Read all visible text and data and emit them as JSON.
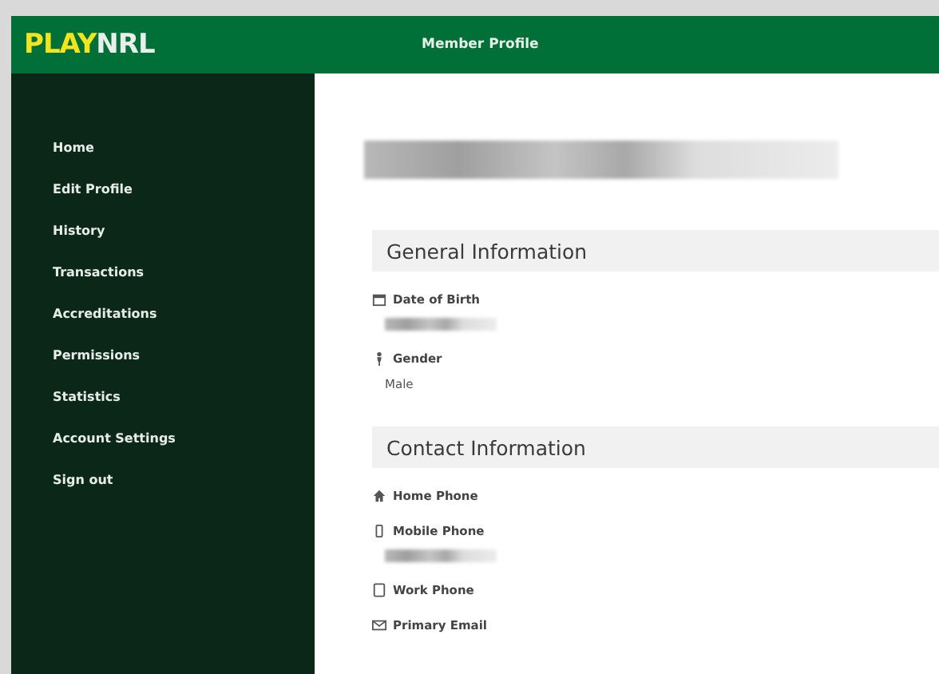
{
  "header": {
    "logo_part_1": "PLAY",
    "logo_part_2": "NRL",
    "title": "Member Profile"
  },
  "sidebar": {
    "items": [
      {
        "label": "Home"
      },
      {
        "label": "Edit Profile"
      },
      {
        "label": "History"
      },
      {
        "label": "Transactions"
      },
      {
        "label": "Accreditations"
      },
      {
        "label": "Permissions"
      },
      {
        "label": "Statistics"
      },
      {
        "label": "Account Settings"
      },
      {
        "label": "Sign out"
      }
    ]
  },
  "profile": {
    "name_hidden": true
  },
  "sections": [
    {
      "title": "General Information",
      "fields": [
        {
          "kind": "calendar",
          "label": "Date of Birth",
          "value_hidden": true
        },
        {
          "kind": "gender",
          "label": "Gender",
          "value": "Male"
        }
      ]
    },
    {
      "title": "Contact Information",
      "fields": [
        {
          "kind": "home",
          "label": "Home Phone"
        },
        {
          "kind": "mobile",
          "label": "Mobile Phone",
          "value_hidden": true
        },
        {
          "kind": "phone",
          "label": "Work Phone"
        },
        {
          "kind": "email",
          "label": "Primary Email"
        }
      ]
    }
  ]
}
